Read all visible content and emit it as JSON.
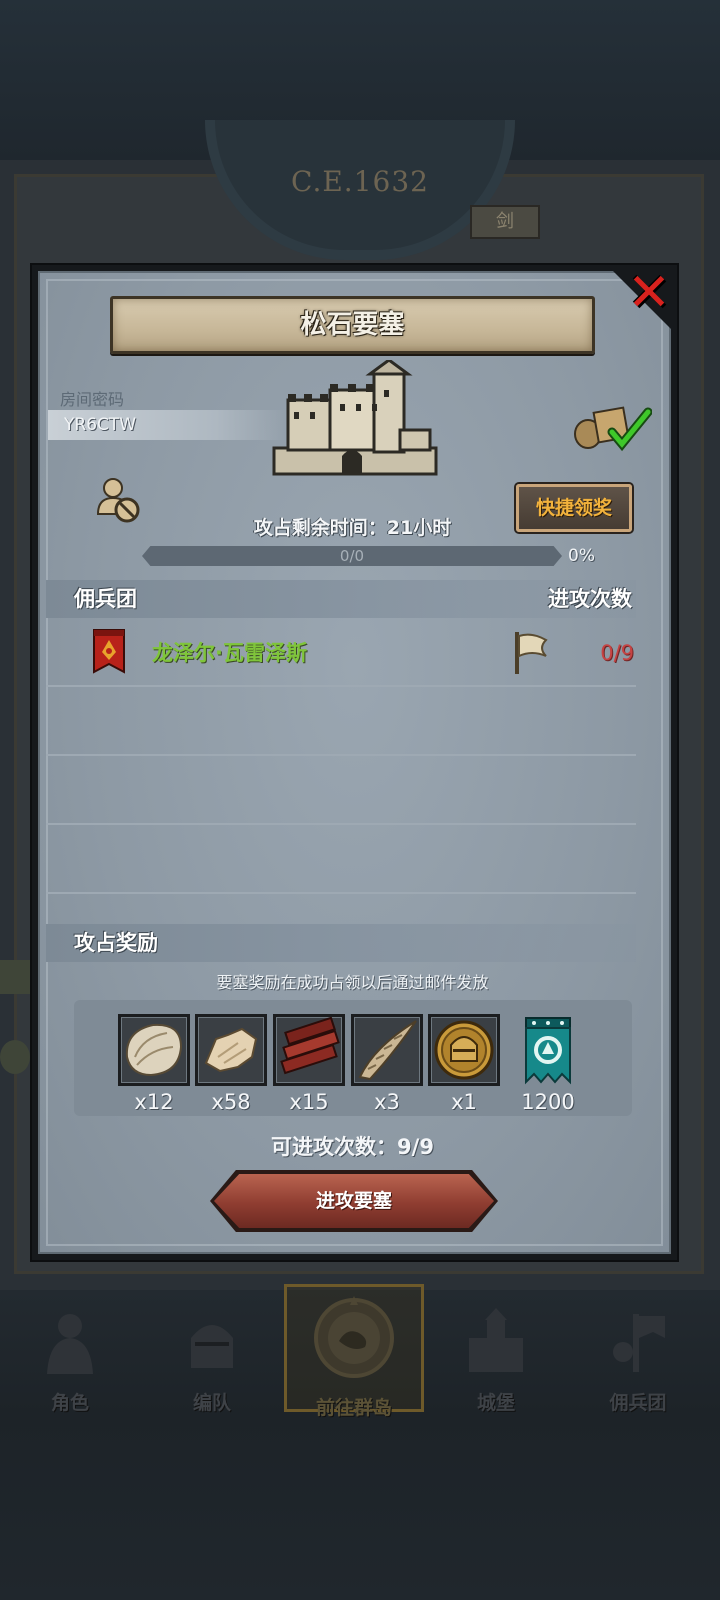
{
  "background": {
    "era": "C.E.1632",
    "sword_tab": "剑"
  },
  "dialog": {
    "title": "松石要塞",
    "room_code_label": "房间密码",
    "room_code": "YR6CTW",
    "quick_claim_label": "快捷领奖",
    "time_remaining_label": "攻占剩余时间：21小时",
    "progress": {
      "text": "0/0",
      "percent_text": "0%",
      "fraction": 0
    },
    "mercenary_section": {
      "left_header": "佣兵团",
      "right_header": "进攻次数",
      "rows": [
        {
          "name": "龙泽尔·瓦雷泽斯",
          "attack_count": "0/9",
          "banner_icon": "red-banner-icon",
          "flag_icon": "white-flag-icon"
        }
      ],
      "empty_rows": 3
    },
    "reward_section": {
      "header": "攻占奖励",
      "note": "要塞奖励在成功占领以后通过邮件发放",
      "items": [
        {
          "icon": "fur-pelt-icon",
          "qty": "x12"
        },
        {
          "icon": "hide-leather-icon",
          "qty": "x58"
        },
        {
          "icon": "timber-planks-icon",
          "qty": "x15"
        },
        {
          "icon": "horn-icon",
          "qty": "x3"
        },
        {
          "icon": "knight-helmet-coin-icon",
          "qty": "x1"
        },
        {
          "icon": "guild-banner-icon",
          "qty": "1200"
        }
      ]
    },
    "attack_remaining_label": "可进攻次数：9/9",
    "attack_button_label": "进攻要塞",
    "close_icon": "close-x-icon"
  },
  "bottom_nav": [
    {
      "label": "角色",
      "icon": "character-knight-icon",
      "active": false
    },
    {
      "label": "编队",
      "icon": "formation-helmet-icon",
      "active": false
    },
    {
      "label": "前往群岛",
      "icon": "compass-island-icon",
      "active": true
    },
    {
      "label": "城堡",
      "icon": "castle-icon",
      "active": false
    },
    {
      "label": "佣兵团",
      "icon": "mercenary-icon",
      "active": false
    }
  ],
  "colors": {
    "dialog_bg": "#8d99a4",
    "merc_name": "#7fc53a",
    "attack_count": "#c54343",
    "quick_claim_text": "#f2b23c",
    "attack_button": "#8f3d31",
    "close_icon": "#d8221e"
  }
}
